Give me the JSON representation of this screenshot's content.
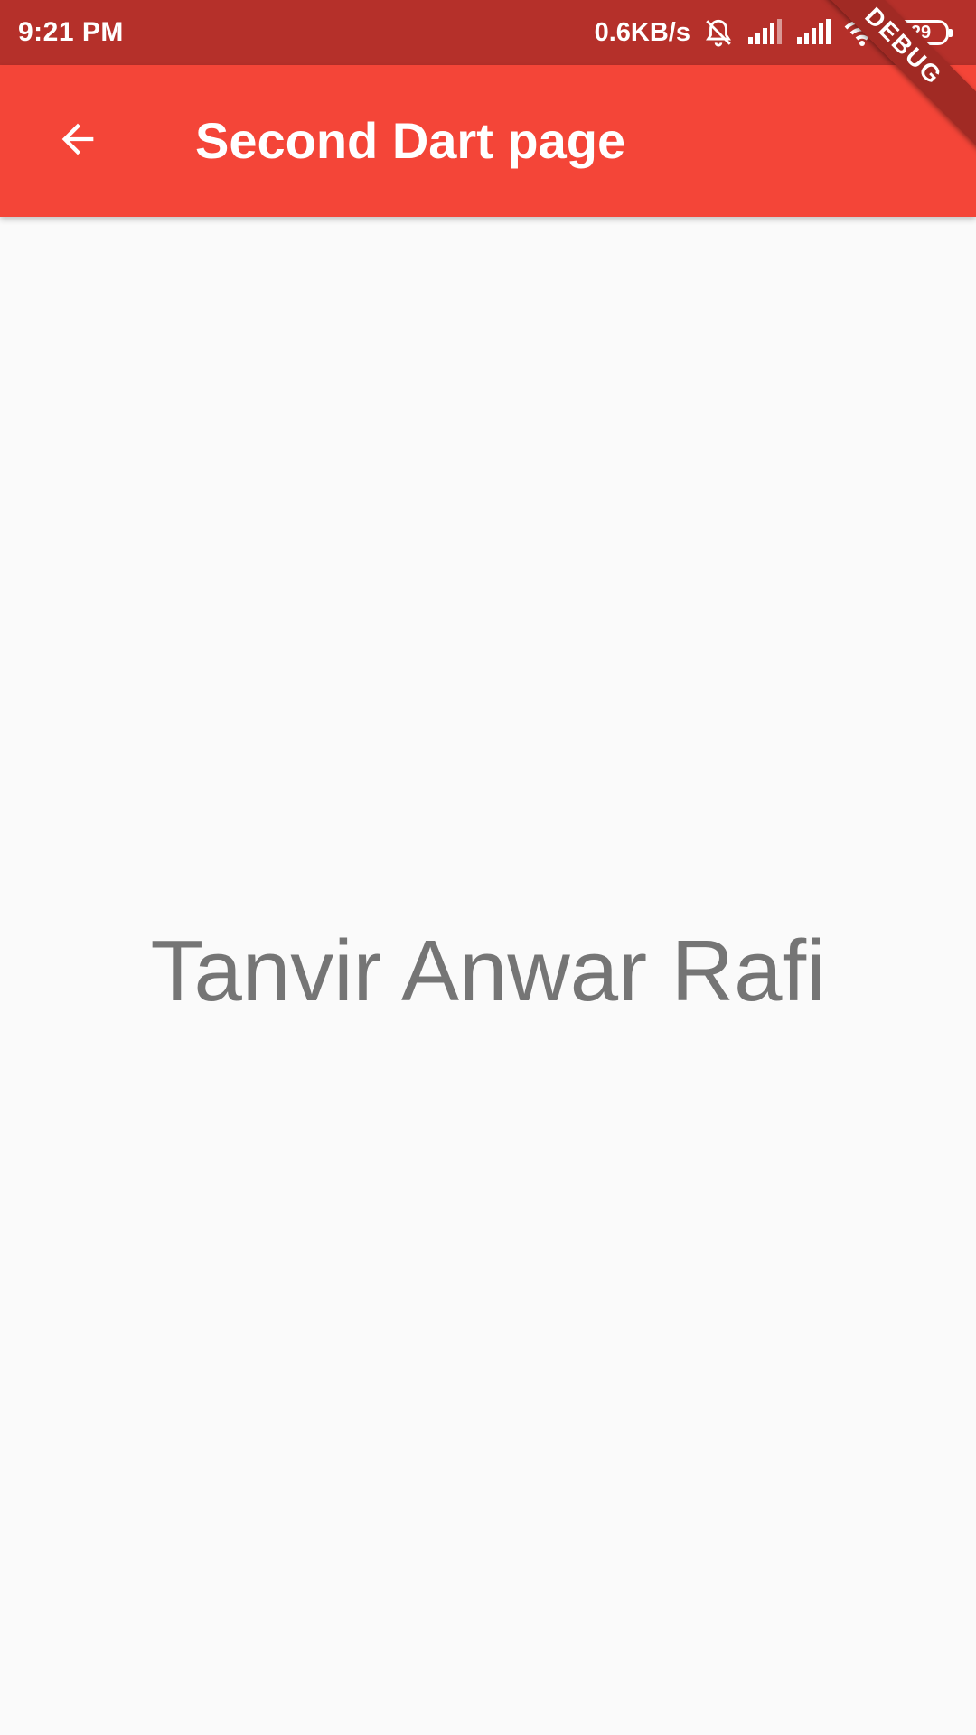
{
  "status_bar": {
    "time": "9:21 PM",
    "net_speed": "0.6KB/s",
    "battery": "29",
    "icons": [
      "muted-bell-icon",
      "signal-icon",
      "signal-icon",
      "wifi-icon",
      "battery-icon"
    ]
  },
  "app_bar": {
    "title": "Second Dart page",
    "back_icon": "arrow-back-icon",
    "color": "#f44538"
  },
  "debug_banner": {
    "label": "DEBUG"
  },
  "body": {
    "text": "Tanvir Anwar Rafi"
  },
  "colors": {
    "status_bar": "#b5302a",
    "background": "#fafafa",
    "text": "#757575"
  }
}
